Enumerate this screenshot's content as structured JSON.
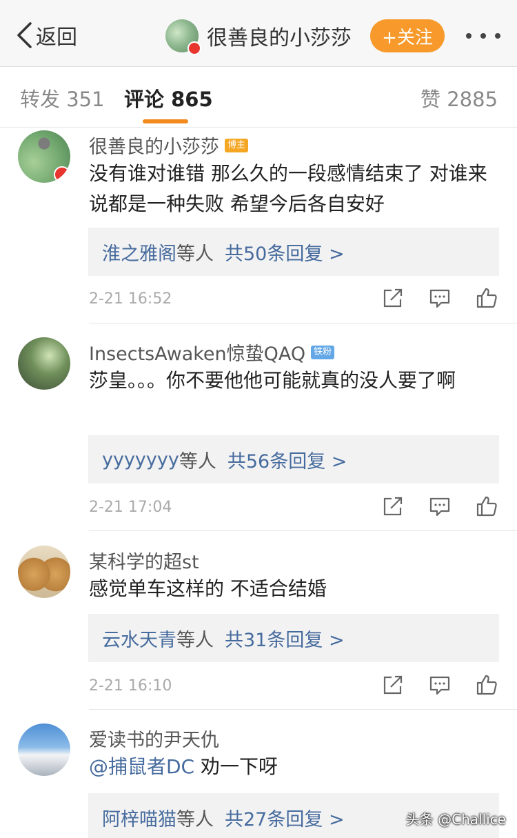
{
  "nav": {
    "back_label": "返回",
    "title": "很善良的小莎莎",
    "follow_label": "+关注",
    "back_icon": "chevron-left-icon",
    "more_icon": "more-icon"
  },
  "tabs": [
    {
      "label": "转发",
      "count": "351"
    },
    {
      "label": "评论",
      "count": "865"
    },
    {
      "label": "赞",
      "count": "2885"
    }
  ],
  "comments": [
    {
      "username": "很善良的小莎莎",
      "tag": "博主",
      "text": "没有谁对谁错 那么久的一段感情结束了 对谁来说都是一种失败 希望今后各自安好",
      "reply_names": "淮之雅阁",
      "reply_etc": "等人",
      "reply_count": "共50条回复 >",
      "time": "2-21 16:52"
    },
    {
      "username": "InsectsAwaken惊蛰QAQ",
      "tag": "铁粉",
      "text": "莎皇。。。你不要他他可能就真的没人要了啊",
      "reply_names": "yyyyyyy",
      "reply_etc": "等人",
      "reply_count": "共56条回复 >",
      "time": "2-21 17:04"
    },
    {
      "username": "某科学的超st",
      "text": "感觉单车这样的 不适合结婚",
      "reply_names": "云水天青",
      "reply_etc": "等人",
      "reply_count": "共31条回复 >",
      "time": "2-21 16:10"
    },
    {
      "username": "爱读书的尹天仇",
      "mention": "@捕鼠者DC",
      "text": " 劝一下呀",
      "reply_names": "阿梓喵猫",
      "reply_etc": "等人",
      "reply_count": "共27条回复 >"
    }
  ],
  "watermark": "头条 @Challice",
  "colors": {
    "accent": "#f79a2b",
    "link": "#466b9e",
    "verified_badge": "#e8362f"
  }
}
